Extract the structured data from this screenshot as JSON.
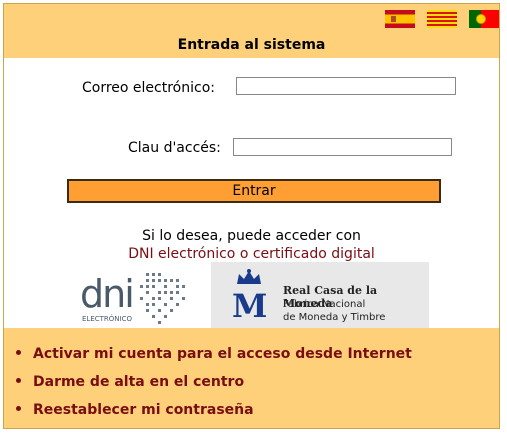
{
  "languages": [
    "Español",
    "Català",
    "Português"
  ],
  "header": {
    "title": "Entrada al sistema"
  },
  "form": {
    "email_label": "Correo electrónico:",
    "email_value": "",
    "password_label": "Clau d'accés:",
    "password_value": "",
    "submit_label": "Entrar"
  },
  "alt_access": {
    "intro": "Si lo desea, puede acceder con",
    "link": "DNI electrónico o certificado digital"
  },
  "logos": {
    "dni": {
      "main": "dni",
      "sub": "ELECTRÓNICO"
    },
    "fnmt": {
      "line1": "Real Casa de la Moneda",
      "line2": "Fábrica Nacional",
      "line3": "de Moneda y Timbre"
    }
  },
  "links": [
    "Activar mi cuenta para el acceso desde Internet",
    "Darme de alta en el centro",
    "Reestablecer mi contraseña"
  ],
  "colors": {
    "accent": "#ffd07a",
    "button": "#ff9f33",
    "link": "#7a0d12"
  }
}
